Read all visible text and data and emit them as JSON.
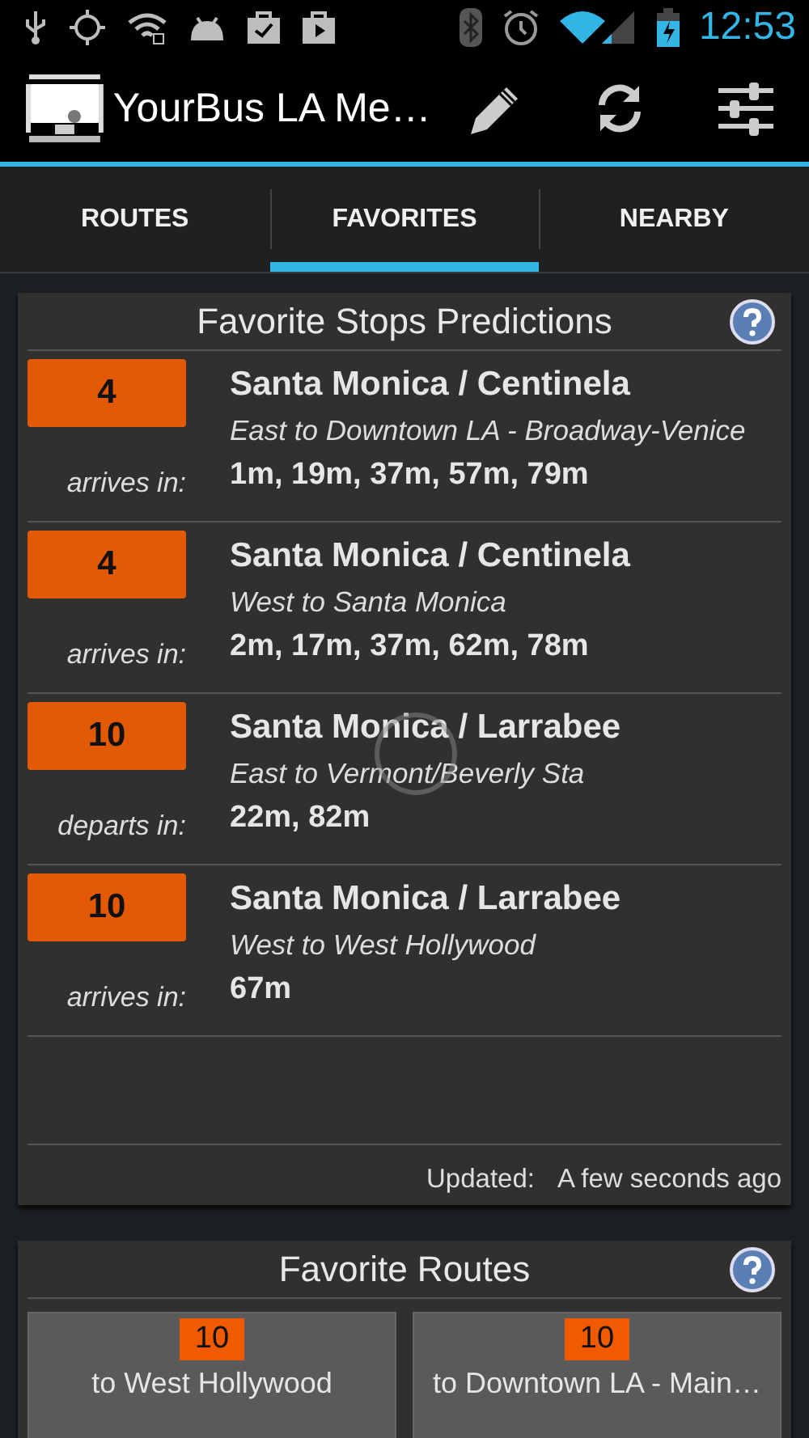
{
  "status_bar": {
    "time": "12:53"
  },
  "action_bar": {
    "title": "YourBus LA Me…"
  },
  "tabs": [
    {
      "label": "ROUTES",
      "selected": false
    },
    {
      "label": "FAVORITES",
      "selected": true
    },
    {
      "label": "NEARBY",
      "selected": false
    }
  ],
  "stops_card": {
    "title": "Favorite Stops Predictions",
    "loading": true,
    "predictions": [
      {
        "route": "4",
        "stop": "Santa Monica / Centinela",
        "direction": "East to Downtown LA - Broadway-Venice",
        "time_label": "arrives in:",
        "times": "1m, 19m, 37m, 57m, 79m"
      },
      {
        "route": "4",
        "stop": "Santa Monica / Centinela",
        "direction": "West to Santa Monica",
        "time_label": "arrives in:",
        "times": "2m, 17m, 37m, 62m, 78m"
      },
      {
        "route": "10",
        "stop": "Santa Monica / Larrabee",
        "direction": "East to Vermont/Beverly Sta",
        "time_label": "departs in:",
        "times": "22m, 82m"
      },
      {
        "route": "10",
        "stop": "Santa Monica / Larrabee",
        "direction": "West to West Hollywood",
        "time_label": "arrives in:",
        "times": "67m"
      }
    ],
    "updated_label": "Updated:",
    "updated_value": "A few seconds ago"
  },
  "routes_card": {
    "title": "Favorite Routes",
    "routes": [
      {
        "route": "10",
        "destination": "to West Hollywood"
      },
      {
        "route": "10",
        "destination": "to Downtown LA - Main…"
      }
    ]
  }
}
